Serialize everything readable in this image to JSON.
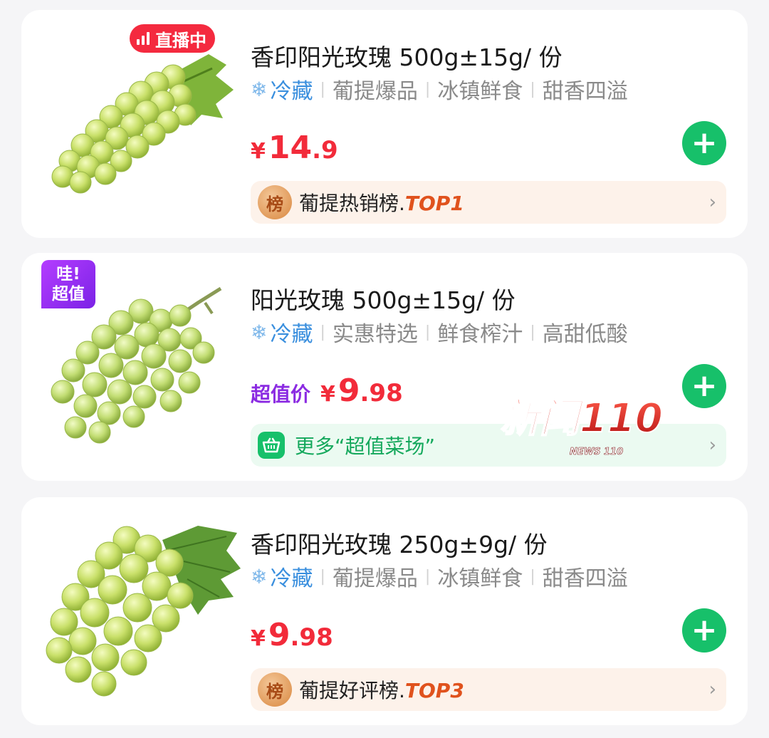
{
  "products": [
    {
      "badge": "直播中",
      "title": "香印阳光玫瑰 500g±15g/ 份",
      "storage": "冷藏",
      "tags": [
        "葡提爆品",
        "冰镇鲜食",
        "甜香四溢"
      ],
      "price_currency": "¥",
      "price_int": "14",
      "price_dec": ".9",
      "rank_icon": "榜",
      "rank_label": "葡提热销榜.",
      "rank_top": "TOP1"
    },
    {
      "badge_line1": "哇!",
      "badge_line2": "超值",
      "title": "阳光玫瑰 500g±15g/ 份",
      "storage": "冷藏",
      "tags": [
        "实惠特选",
        "鲜食榨汁",
        "高甜低酸"
      ],
      "price_prefix": "超值价",
      "price_currency": "¥",
      "price_int": "9",
      "price_dec": ".98",
      "more_label": "更多“超值菜场”"
    },
    {
      "title": "香印阳光玫瑰 250g±9g/ 份",
      "storage": "冷藏",
      "tags": [
        "葡提爆品",
        "冰镇鲜食",
        "甜香四溢"
      ],
      "price_currency": "¥",
      "price_int": "9",
      "price_dec": ".98",
      "rank_icon": "榜",
      "rank_label": "葡提好评榜.",
      "rank_top": "TOP3"
    }
  ],
  "icons": {
    "storage": "snowflake-icon",
    "add": "plus-icon",
    "chevron": "chevron-right-icon",
    "basket": "basket-icon"
  },
  "add_symbol": "+",
  "chevron_symbol": "›",
  "snow_symbol": "❄",
  "watermark": {
    "main": "新闻110",
    "sub": "NEWS 110"
  },
  "colors": {
    "price": "#f22b3a",
    "add_button": "#17c06a",
    "live_badge": "#f42a3f",
    "value_badge": "#8b2be2",
    "storage_text": "#3a8fde"
  }
}
